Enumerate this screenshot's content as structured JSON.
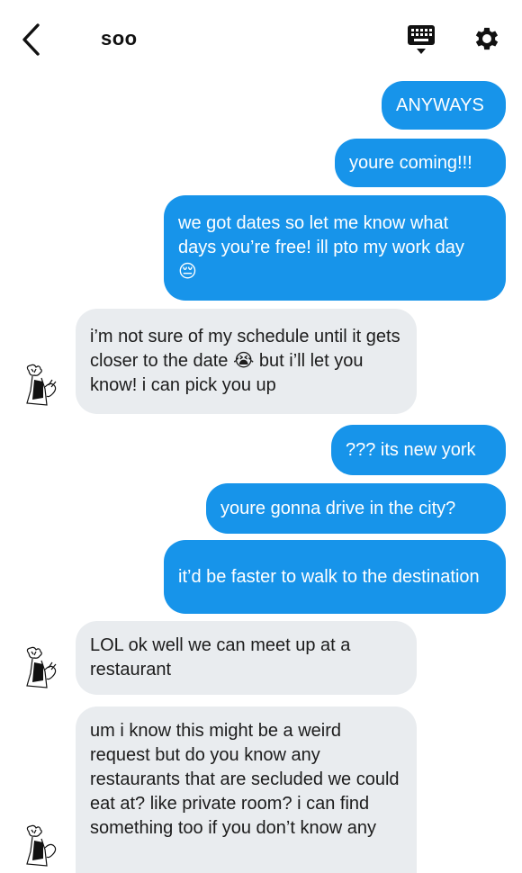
{
  "header": {
    "title": "soo",
    "back_icon": "chevron-left-icon",
    "keyboard_icon": "keyboard-icon",
    "settings_icon": "gear-icon"
  },
  "colors": {
    "outgoing": "#1794ea",
    "incoming": "#e9ecef",
    "text_dark": "#1c1c1c"
  },
  "messages": [
    {
      "side": "out",
      "text": "ANYWAYS"
    },
    {
      "side": "out",
      "text": "youre coming!!!"
    },
    {
      "side": "out",
      "text": "we got dates so let me know what days you’re free! ill pto my work day 😔"
    },
    {
      "side": "in",
      "text": "i’m not sure of my schedule until it gets closer to the date 😭  but i’ll let you know! i can pick you up"
    },
    {
      "side": "out",
      "text": "??? its new york"
    },
    {
      "side": "out",
      "text": "youre gonna drive in the city?"
    },
    {
      "side": "out",
      "text": "it’d be faster to walk to the destination"
    },
    {
      "side": "in",
      "text": "LOL ok well we can meet up at a restaurant"
    },
    {
      "side": "in",
      "text": "um i know this might be a weird request but do you know any restaurants that are secluded we could eat at? like private room? i can find something too if you don’t know any"
    }
  ]
}
